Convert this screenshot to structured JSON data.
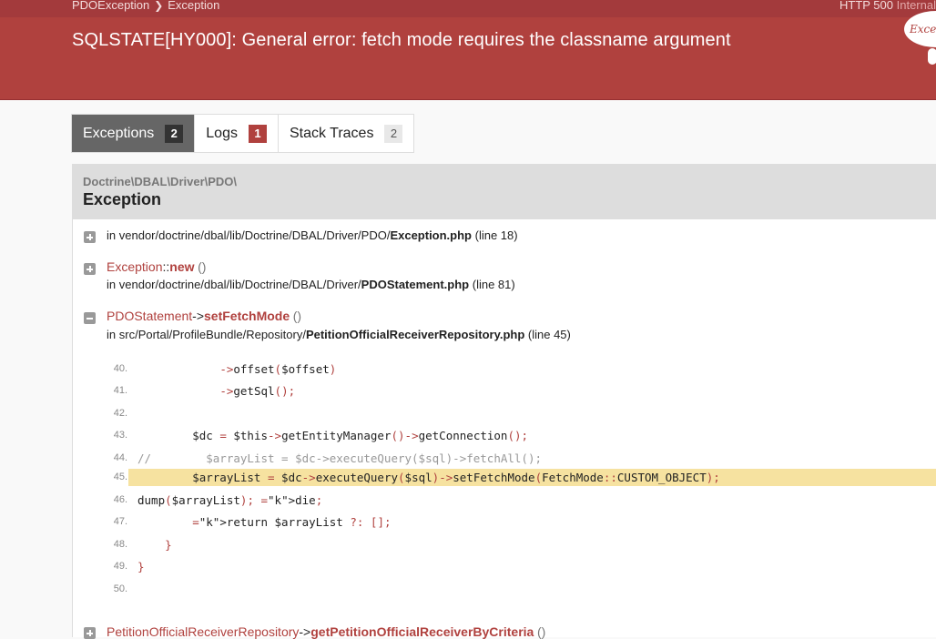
{
  "header": {
    "breadcrumb": [
      "PDOException",
      "Exception"
    ],
    "status_code": "HTTP 500",
    "status_text": "Internal",
    "message": "SQLSTATE[HY000]: General error: fetch mode requires the classname argument",
    "badge_text": "Exception"
  },
  "tabs": [
    {
      "label": "Exceptions",
      "count": "2"
    },
    {
      "label": "Logs",
      "count": "1"
    },
    {
      "label": "Stack Traces",
      "count": "2"
    }
  ],
  "exception": {
    "namespace": "Doctrine\\DBAL\\Driver\\PDO\\",
    "class": "Exception"
  },
  "traces": [
    {
      "in": "in",
      "path": "vendor/doctrine/dbal/lib/Doctrine/DBAL/Driver/PDO/",
      "file": "Exception.php",
      "line": "(line 18)"
    },
    {
      "class": "Exception",
      "op": "::",
      "method": "new",
      "args": "()",
      "in": "in",
      "path": "vendor/doctrine/dbal/lib/Doctrine/DBAL/Driver/",
      "file": "PDOStatement.php",
      "line": "(line 81)"
    },
    {
      "class": "PDOStatement",
      "op": "->",
      "method": "setFetchMode",
      "args": "()",
      "in": "in",
      "path": "src/Portal/ProfileBundle/Repository/",
      "file": "PetitionOfficialReceiverRepository.php",
      "line": "(line 45)"
    },
    {
      "class": "PetitionOfficialReceiverRepository",
      "op": "->",
      "method": "getPetitionOfficialReceiverByCriteria",
      "args": "()"
    }
  ],
  "code": [
    {
      "n": "40.",
      "t": "            ->offset($offset)"
    },
    {
      "n": "41.",
      "t": "            ->getSql();"
    },
    {
      "n": "42.",
      "t": ""
    },
    {
      "n": "43.",
      "t": "        $dc = $this->getEntityManager()->getConnection();"
    },
    {
      "n": "44.",
      "t": "//        $arrayList = $dc->executeQuery($sql)->fetchAll();"
    },
    {
      "n": "45.",
      "t": "        $arrayList = $dc->executeQuery($sql)->setFetchMode(FetchMode::CUSTOM_OBJECT);"
    },
    {
      "n": "46.",
      "t": "dump($arrayList); die;"
    },
    {
      "n": "47.",
      "t": "        return $arrayList ?: [];"
    },
    {
      "n": "48.",
      "t": "    }"
    },
    {
      "n": "49.",
      "t": "}"
    },
    {
      "n": "50.",
      "t": ""
    }
  ],
  "colors": {
    "brand": "#b0413e",
    "highlight": "#f6e2a0"
  }
}
